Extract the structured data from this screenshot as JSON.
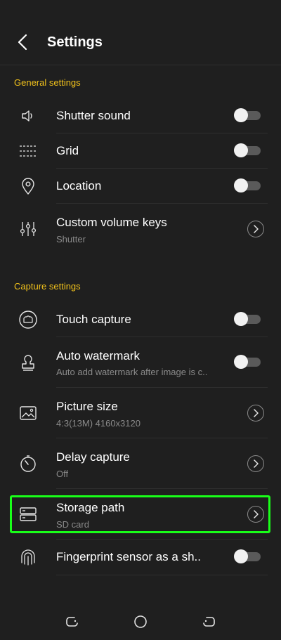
{
  "header": {
    "title": "Settings",
    "back_icon": "chevron-left-icon"
  },
  "sections": [
    {
      "title": "General settings",
      "items": [
        {
          "title": "Shutter sound",
          "icon": "speaker-icon",
          "control": "toggle",
          "on": false
        },
        {
          "title": "Grid",
          "icon": "grid-icon",
          "control": "toggle",
          "on": false
        },
        {
          "title": "Location",
          "icon": "location-pin-icon",
          "control": "toggle",
          "on": false
        },
        {
          "title": "Custom volume keys",
          "subtitle": "Shutter",
          "icon": "sliders-icon",
          "control": "chevron"
        }
      ]
    },
    {
      "title": "Capture settings",
      "items": [
        {
          "title": "Touch capture",
          "icon": "touch-capture-icon",
          "control": "toggle",
          "on": false
        },
        {
          "title": "Auto watermark",
          "subtitle": "Auto add watermark after image is c..",
          "icon": "stamp-icon",
          "control": "toggle",
          "on": false
        },
        {
          "title": "Picture size",
          "subtitle": "4:3(13M) 4160x3120",
          "icon": "image-icon",
          "control": "chevron"
        },
        {
          "title": "Delay capture",
          "subtitle": "Off",
          "icon": "timer-icon",
          "control": "chevron"
        },
        {
          "title": "Storage path",
          "subtitle": "SD card",
          "icon": "storage-icon",
          "control": "chevron",
          "highlighted": true
        },
        {
          "title": "Fingerprint sensor as a sh..",
          "icon": "fingerprint-icon",
          "control": "toggle",
          "on": false
        }
      ]
    }
  ],
  "navbar": {
    "recents_icon": "recents-icon",
    "home_icon": "home-circle-icon",
    "back_icon": "back-nav-icon"
  },
  "colors": {
    "background": "#1f1f1f",
    "section_title": "#f2c21b",
    "highlight": "#19ff19",
    "subtitle": "#8a8a8a"
  }
}
